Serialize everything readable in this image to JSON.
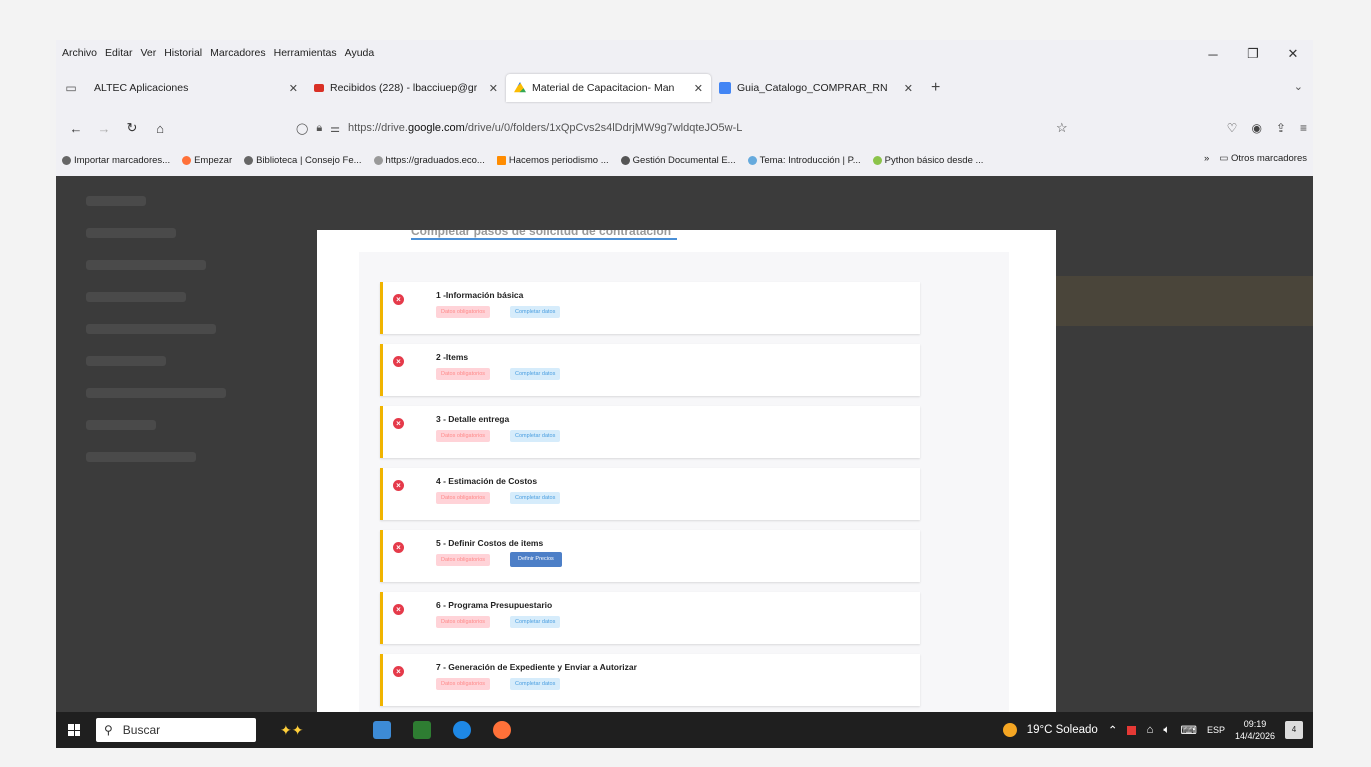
{
  "menu": [
    "Archivo",
    "Editar",
    "Ver",
    "Historial",
    "Marcadores",
    "Herramientas",
    "Ayuda"
  ],
  "tabs": [
    {
      "label": "ALTEC Aplicaciones",
      "color": "#888888"
    },
    {
      "label": "Recibidos (228) - lbacciuep@gr",
      "color": "#d93025"
    },
    {
      "label": "Material de Capacitacion- Man",
      "color": "#1a73e8"
    },
    {
      "label": "Guia_Catalogo_COMPRAR_RN",
      "color": "#4285f4"
    }
  ],
  "url": {
    "prefix": "https://drive.",
    "host": "google.com",
    "path": "/drive/u/0/folders/1xQpCvs2s4lDdrjMW9g7wldqteJO5w-L"
  },
  "bookmarks": [
    {
      "label": "Importar marcadores...",
      "color": "#666666"
    },
    {
      "label": "Empezar",
      "color": "#ff7139"
    },
    {
      "label": "Biblioteca | Consejo Fe...",
      "color": "#666666"
    },
    {
      "label": "https://graduados.eco...",
      "color": "#999999"
    },
    {
      "label": "Hacemos periodismo ...",
      "color": "#ff8c00"
    },
    {
      "label": "Gestión Documental E...",
      "color": "#555555"
    },
    {
      "label": "Tema: Introducción | P...",
      "color": "#66aadd"
    },
    {
      "label": "Python básico desde ...",
      "color": "#8bc34a"
    }
  ],
  "bookmarks_more": "»",
  "bookmarks_other": "Otros marcadores",
  "doc_heading": "Completar pasos de solicitud de contratación",
  "steps": [
    {
      "title": "1 -Información básica",
      "status": "Datos obligatorios",
      "action": "Completar datos",
      "action_style": "badge"
    },
    {
      "title": "2 -Items",
      "status": "Datos obligatorios",
      "action": "Completar datos",
      "action_style": "badge"
    },
    {
      "title": "3 - Detalle entrega",
      "status": "Datos obligatorios",
      "action": "Completar datos",
      "action_style": "badge"
    },
    {
      "title": "4 - Estimación de Costos",
      "status": "Datos obligatorios",
      "action": "Completar datos",
      "action_style": "badge"
    },
    {
      "title": "5 - Definir Costos de items",
      "status": "Datos obligatorios",
      "action": "Definir Precios",
      "action_style": "button"
    },
    {
      "title": "6 - Programa Presupuestario",
      "status": "Datos obligatorios",
      "action": "Completar datos",
      "action_style": "badge"
    },
    {
      "title": "7 - Generación de Expediente y Enviar a Autorizar",
      "status": "Datos obligatorios",
      "action": "Completar datos",
      "action_style": "badge"
    }
  ],
  "taskbar": {
    "search_placeholder": "Buscar",
    "weather": "19°C Soleado",
    "lang": "ESP",
    "time": "09:19",
    "date": "14/4/2026",
    "notifications": "4",
    "app_colors": [
      "#3d8bd6",
      "#2e7d32",
      "#1e88e5",
      "#ff7139"
    ]
  }
}
